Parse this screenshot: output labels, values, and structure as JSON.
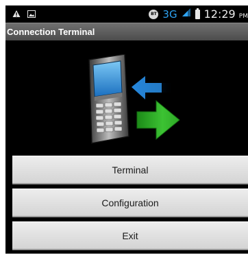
{
  "status_bar": {
    "bt_badge": "BT",
    "network_type": "3G",
    "clock_time": "12:29",
    "clock_suffix": "PM",
    "icons": [
      "warning-icon",
      "image-icon",
      "bluetooth-icon",
      "signal-icon",
      "battery-icon"
    ],
    "network_color": "#2ea3f2"
  },
  "app": {
    "title": "Connection Terminal",
    "hero_icons": [
      "phone-icon",
      "incoming-arrow-icon",
      "outgoing-arrow-icon"
    ],
    "colors": {
      "incoming_arrow": "#1f8ee0",
      "outgoing_arrow": "#34b82a",
      "phone_screen": "#39a0e8"
    }
  },
  "menu": {
    "terminal_label": "Terminal",
    "configuration_label": "Configuration",
    "exit_label": "Exit"
  }
}
